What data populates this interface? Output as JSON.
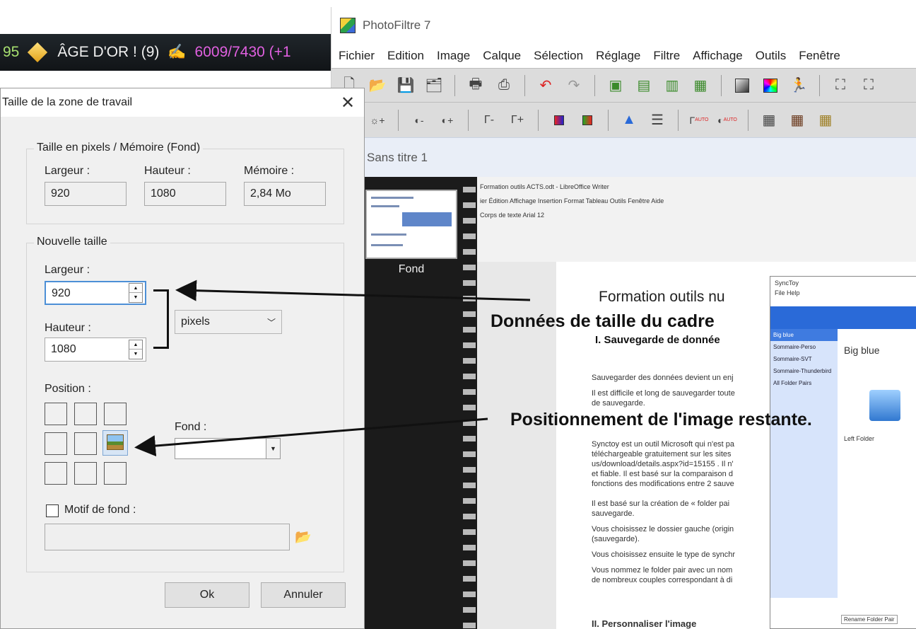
{
  "game": {
    "number": "95",
    "gold_label": "ÂGE D'OR ! (9)",
    "ratio": "6009/7430 (+1"
  },
  "photofiltre": {
    "title": "PhotoFiltre 7",
    "menu": [
      "Fichier",
      "Edition",
      "Image",
      "Calque",
      "Sélection",
      "Réglage",
      "Filtre",
      "Affichage",
      "Outils",
      "Fenêtre"
    ],
    "doc_title": "Sans titre 1",
    "layer_label": "Fond"
  },
  "writer": {
    "top_lines": [
      "Formation outils ACTS.odt - LibreOffice Writer",
      "ier  Édition  Affichage  Insertion  Format  Tableau  Outils  Fenêtre  Aide",
      "Corps de texte     Arial     12"
    ],
    "heading": "Formation outils nu",
    "section": "I.  Sauvegarde de donnée",
    "body_lines": [
      "Sauvegarder des données devient un enj",
      "Il est difficile et long de sauvegarder toute",
      "de sauvegarde.",
      "Synctoy est un outil Microsoft qui n'est pa",
      "téléchargeable gratuitement sur les sites",
      "us/download/details.aspx?id=15155 . Il n'",
      "et fiable. Il est basé sur la comparaison d",
      "fonctions des modifications entre 2 sauve",
      "Il est basé sur la création de « folder pai",
      "sauvegarde.",
      "Vous choisissez le dossier gauche (origin",
      "(sauvegarde).",
      "Vous choisissez ensuite le type de synchr",
      "Vous nommez le folder pair avec un nom",
      "de nombreux couples correspondant à di"
    ],
    "bottom_text": "II.  Personnaliser l'image"
  },
  "synctoy": {
    "title": "SyncToy",
    "menu": "File  Help",
    "items": [
      "Big blue",
      "Sommaire-Perso",
      "Sommaire-SVT",
      "Sommaire-Thunderbird",
      "All Folder Pairs"
    ],
    "right_title": "Big blue",
    "left_folder": "Left Folder",
    "rename_button": "Rename Folder Pair"
  },
  "annotations": {
    "size": "Données de taille du cadre",
    "position": "Positionnement de l'image restante."
  },
  "dialog": {
    "title": "Taille de la zone de travail",
    "group_memory": "Taille en pixels / Mémoire (Fond)",
    "width_label": "Largeur :",
    "height_label": "Hauteur :",
    "memory_label": "Mémoire :",
    "width_value": "920",
    "height_value": "1080",
    "memory_value": "2,84 Mo",
    "group_new": "Nouvelle taille",
    "new_width_label": "Largeur :",
    "new_width_value": "920",
    "new_height_label": "Hauteur :",
    "new_height_value": "1080",
    "unit_selected": "pixels",
    "position_label": "Position :",
    "fond_label": "Fond :",
    "motif_label": "Motif de fond :",
    "ok": "Ok",
    "cancel": "Annuler"
  },
  "icons": {
    "close": "close-icon",
    "spin_up": "chevron-up-icon",
    "spin_down": "chevron-down-icon",
    "folder": "folder-open-icon",
    "landscape": "landscape-image-icon"
  },
  "colors": {
    "focus_border": "#4c8fd6",
    "dialog_bg": "#f0f0f0",
    "doc_header_bg": "#e9eef7",
    "synctoy_blue": "#2a6ad8"
  }
}
